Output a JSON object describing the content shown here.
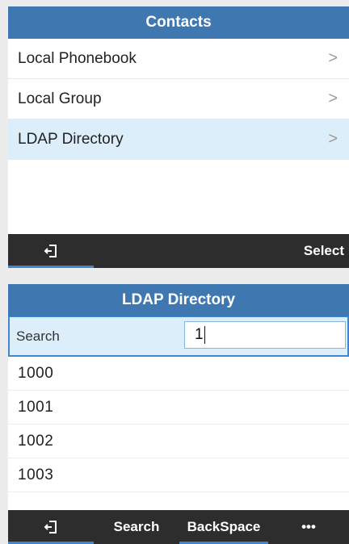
{
  "contacts_screen": {
    "title": "Contacts",
    "items": [
      {
        "label": "Local Phonebook",
        "arrow": ">"
      },
      {
        "label": "Local Group",
        "arrow": ">"
      },
      {
        "label": "LDAP Directory",
        "arrow": ">"
      }
    ],
    "softkeys": {
      "left_icon": "exit-icon",
      "right_label": "Select"
    }
  },
  "ldap_screen": {
    "title": "LDAP Directory",
    "search": {
      "label": "Search",
      "value": "1"
    },
    "results": [
      "1000",
      "1001",
      "1002",
      "1003"
    ],
    "softkeys": {
      "left_icon": "exit-icon",
      "search_label": "Search",
      "backspace_label": "BackSpace",
      "more_label": "•••"
    }
  },
  "colors": {
    "title_bar": "#3f78b1",
    "selection": "#dceef9",
    "softkey_bar": "#2d2d2d",
    "accent": "#3f86cf"
  }
}
